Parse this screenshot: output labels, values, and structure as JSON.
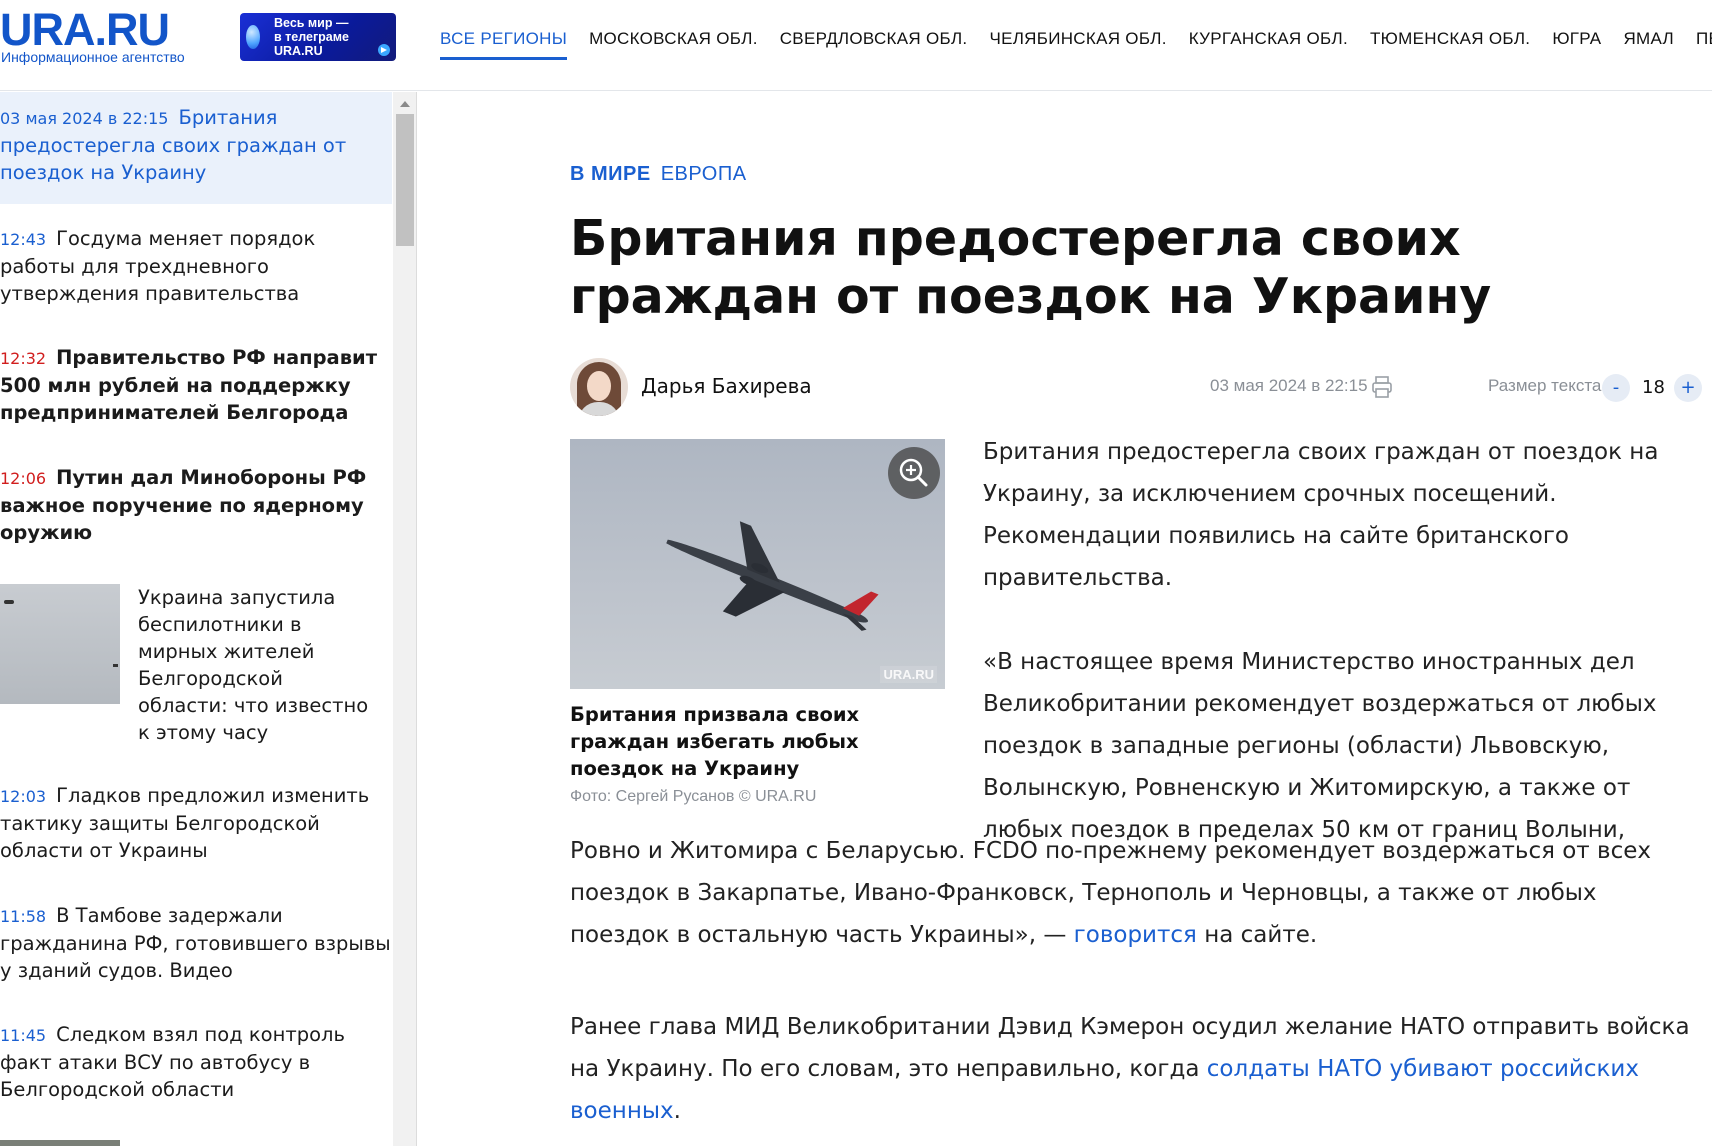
{
  "logo": {
    "name": "URA.RU",
    "subtitle": "Информационное агентство"
  },
  "promo": {
    "text": "Весь мир —\nв телеграме\nURA.RU"
  },
  "nav": [
    {
      "label": "ВСЕ РЕГИОНЫ",
      "active": true
    },
    {
      "label": "МОСКОВСКАЯ ОБЛ."
    },
    {
      "label": "СВЕРДЛОВСКАЯ ОБЛ."
    },
    {
      "label": "ЧЕЛЯБИНСКАЯ ОБЛ."
    },
    {
      "label": "КУРГАНСКАЯ ОБЛ."
    },
    {
      "label": "ТЮМЕНСКАЯ ОБЛ."
    },
    {
      "label": "ЮГРА"
    },
    {
      "label": "ЯМАЛ"
    },
    {
      "label": "ПЕРМСКИЙ"
    }
  ],
  "sidebar": {
    "items": [
      {
        "time": "03 мая 2024 в 22:15",
        "title": "Британия предостерегла своих граждан от поездок на Украину",
        "highlight": true
      },
      {
        "time": "12:43",
        "title": "Госдума меняет порядок работы для трехдневного утверждения правительства"
      },
      {
        "time": "12:32",
        "title": "Правительство РФ направит 500 млн рублей на поддержку предпринимателей Белгорода",
        "bold": true,
        "red": true
      },
      {
        "time": "12:06",
        "title": "Путин дал Минобороны РФ важное поручение по ядерному оружию",
        "bold": true,
        "red": true
      },
      {
        "title": "Украина запустила беспилотники в мирных жителей Белгородской области: что известно к этому часу",
        "tail": "часу",
        "thumb": true
      },
      {
        "time": "12:03",
        "title": "Гладков предложил изменить тактику защиты Белгородской области от Украины"
      },
      {
        "time": "11:58",
        "title": "В Тамбове задержали гражданина РФ, готовившего взрывы у зданий судов. Видео"
      },
      {
        "time": "11:45",
        "title": "Следком взял под контроль факт атаки ВСУ по автобусу в Белгородской области"
      }
    ]
  },
  "article": {
    "rubric_primary": "В МИРЕ",
    "rubric_secondary": "ЕВРОПА",
    "title": "Британия предостерегла своих граждан от поездок на Украину",
    "author": "Дарья Бахирева",
    "date": "03 мая 2024 в 22:15",
    "text_size_label": "Размер текста",
    "text_size": "18",
    "text_size_minus": "-",
    "text_size_plus": "+",
    "photo_watermark": "URA.RU",
    "photo_caption": "Британия призвала своих граждан избегать любых поездок на Украину",
    "photo_credit": "Фото: Сергей Русанов © URA.RU",
    "p1": "Британия предостерегла своих граждан от поездок на Украину, за исключением срочных посещений. Рекомендации появились на сайте британского правительства.",
    "p2_a": "«В настоящее время Министерство иностранных дел Великобритании рекомендует воздержаться от любых поездок в западные регионы (области) Львовскую, Волынскую, Ровненскую и Житомирскую, а также от любых поездок в пределах 50 км от границ Волыни,",
    "p2_b": "Ровно и Житомира с Беларусью. FCDO по-прежнему рекомендует воздержаться от всех поездок в Закарпатье, Ивано-Франковск, Тернополь и Черновцы, а также от любых поездок в остальную часть Украины», — ",
    "p2_link": "говорится",
    "p2_end": " на сайте.",
    "p3_a": "Ранее глава МИД Великобритании Дэвид Кэмерон осудил желание НАТО отправить войска на Украину. По его словам, это неправильно, когда ",
    "p3_link": "солдаты НАТО убивают российских военных",
    "p3_end": "."
  },
  "colors": {
    "brand": "#1a5fd0",
    "breaking": "#d11e1e",
    "highlight_bg": "#eaf1fb",
    "muted": "#8a8f96"
  }
}
